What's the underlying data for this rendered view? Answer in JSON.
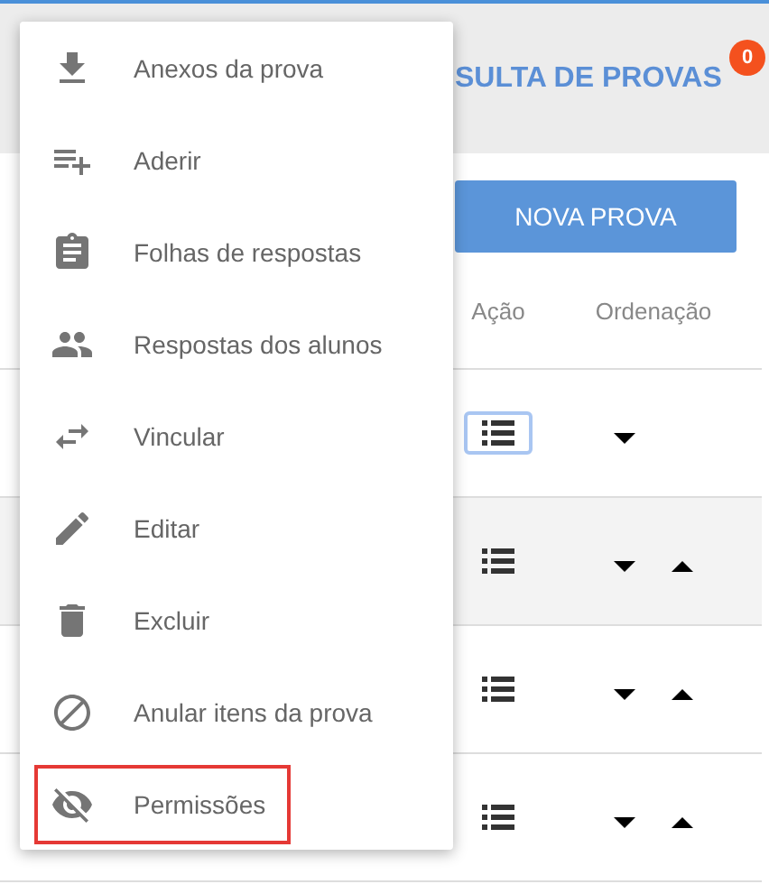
{
  "header": {
    "title": "SULTA DE PROVAS",
    "badge": "0"
  },
  "toolbar": {
    "button": "NOVA PROVA"
  },
  "table": {
    "columns": [
      "Ação",
      "Ordenação"
    ],
    "rows": [
      {
        "shaded": false,
        "focused": true,
        "can_move_up": false
      },
      {
        "shaded": true,
        "focused": false,
        "can_move_up": true
      },
      {
        "shaded": false,
        "focused": false,
        "can_move_up": true
      },
      {
        "shaded": false,
        "focused": false,
        "can_move_up": true
      }
    ]
  },
  "menu": {
    "items": [
      {
        "kind": "download",
        "label": "Anexos da prova",
        "highlighted": false
      },
      {
        "kind": "playlist-add",
        "label": "Aderir",
        "highlighted": false
      },
      {
        "kind": "clipboard",
        "label": "Folhas de respostas",
        "highlighted": false
      },
      {
        "kind": "people",
        "label": "Respostas dos alunos",
        "highlighted": false
      },
      {
        "kind": "swap",
        "label": "Vincular",
        "highlighted": false
      },
      {
        "kind": "pencil",
        "label": "Editar",
        "highlighted": false
      },
      {
        "kind": "trash",
        "label": "Excluir",
        "highlighted": false
      },
      {
        "kind": "block",
        "label": "Anular itens da prova",
        "highlighted": false
      },
      {
        "kind": "eye-off",
        "label": "Permissões",
        "highlighted": true
      }
    ]
  }
}
